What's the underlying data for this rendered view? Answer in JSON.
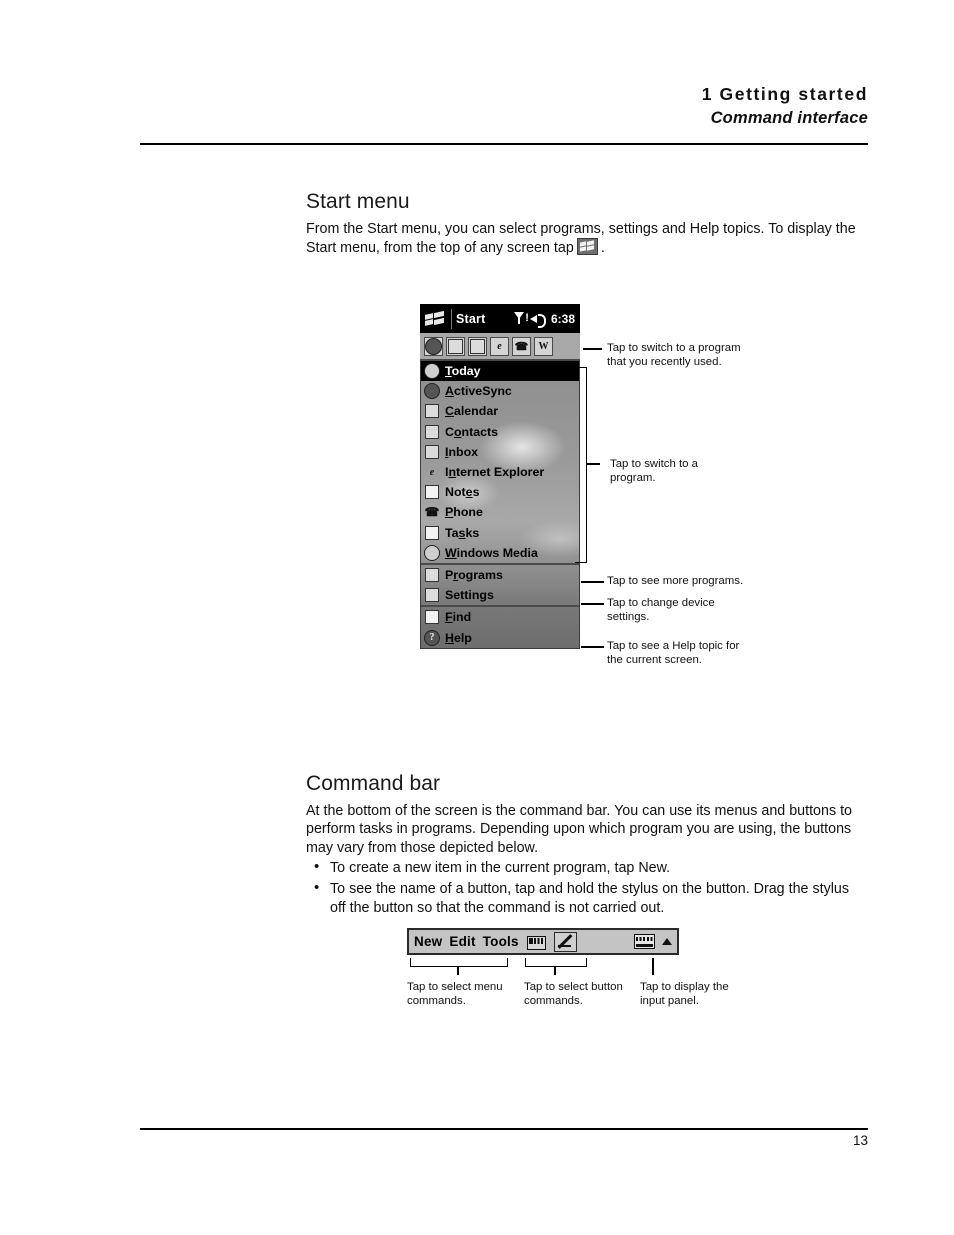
{
  "header": {
    "chapter": "1 Getting started",
    "section": "Command interface"
  },
  "start_menu_section": {
    "title": "Start menu",
    "paragraph_1": "From the Start menu, you can select programs, settings and Help topics. To display the",
    "paragraph_2_before_icon": "Start menu, from the top of any screen tap",
    "paragraph_2_after_icon": "."
  },
  "pda": {
    "titlebar": {
      "start_label": "Start",
      "time": "6:38",
      "signal_icon": "signal-bars-icon",
      "speaker_icon": "speaker-icon",
      "start_icon": "windows-flag-icon"
    },
    "recent_programs": [
      {
        "name": "ActiveSync",
        "icon": "activesync-icon",
        "glyph": ""
      },
      {
        "name": "Calendar",
        "icon": "calendar-icon",
        "glyph": ""
      },
      {
        "name": "Contacts",
        "icon": "contacts-icon",
        "glyph": ""
      },
      {
        "name": "Internet Explorer",
        "icon": "internet-explorer-icon",
        "glyph": "e"
      },
      {
        "name": "Phone",
        "icon": "phone-icon",
        "glyph": ""
      },
      {
        "name": "Word",
        "icon": "word-icon",
        "glyph": "W"
      }
    ],
    "menu_groups": [
      {
        "items": [
          {
            "label": "Today",
            "accel": "T",
            "selected": true,
            "icon": "today-icon"
          },
          {
            "label": "ActiveSync",
            "accel": "A",
            "selected": false,
            "icon": "activesync-icon"
          },
          {
            "label": "Calendar",
            "accel": "C",
            "selected": false,
            "icon": "calendar-icon"
          },
          {
            "label": "Contacts",
            "accel": "o",
            "selected": false,
            "icon": "contacts-icon"
          },
          {
            "label": "Inbox",
            "accel": "I",
            "selected": false,
            "icon": "inbox-icon"
          },
          {
            "label": "Internet Explorer",
            "accel": "n",
            "selected": false,
            "icon": "internet-explorer-icon"
          },
          {
            "label": "Notes",
            "accel": "e",
            "selected": false,
            "icon": "notes-icon"
          },
          {
            "label": "Phone",
            "accel": "P",
            "selected": false,
            "icon": "phone-icon"
          },
          {
            "label": "Tasks",
            "accel": "s",
            "selected": false,
            "icon": "tasks-icon"
          },
          {
            "label": "Windows Media",
            "accel": "W",
            "selected": false,
            "icon": "windows-media-icon"
          }
        ]
      },
      {
        "items": [
          {
            "label": "Programs",
            "accel": "r",
            "selected": false,
            "icon": "programs-folder-icon"
          },
          {
            "label": "Settings",
            "accel": "g",
            "selected": false,
            "icon": "settings-folder-icon"
          }
        ]
      },
      {
        "items": [
          {
            "label": "Find",
            "accel": "F",
            "selected": false,
            "icon": "find-icon"
          },
          {
            "label": "Help",
            "accel": "H",
            "selected": false,
            "icon": "help-icon"
          }
        ]
      }
    ]
  },
  "start_callouts": [
    {
      "id": "recent-programs-callout",
      "line1": "Tap to switch to a program",
      "line2": "that you recently used."
    },
    {
      "id": "switch-program-callout",
      "line1": "Tap to switch to a",
      "line2": "program."
    },
    {
      "id": "programs-callout",
      "line1": "Tap to see more programs.",
      "line2": ""
    },
    {
      "id": "settings-callout",
      "line1": "Tap to change device",
      "line2": "settings."
    },
    {
      "id": "help-callout",
      "line1": "Tap to see a Help topic for",
      "line2": "the current screen."
    }
  ],
  "command_bar_section": {
    "title": "Command bar",
    "paragraph": "At the bottom of the screen is the command bar. You can use its menus and buttons to perform tasks in programs. Depending upon which program you are using, the buttons may vary from those depicted below.",
    "bullets": [
      "To create a new item in the current program, tap New.",
      "To see the name of a button, tap and hold the stylus on the button. Drag the stylus off the button so that the command is not carried out."
    ]
  },
  "command_bar": {
    "menus": [
      "New",
      "Edit",
      "Tools"
    ],
    "buttons": [
      {
        "name": "paragraph-button",
        "icon": "paragraph-icon",
        "pressed": false
      },
      {
        "name": "draw-button",
        "icon": "pencil-icon",
        "pressed": true
      }
    ],
    "input_panel_icon": "keyboard-icon",
    "input_panel_arrow_icon": "up-arrow-icon",
    "captions": [
      {
        "id": "menu-commands-caption",
        "line1": "Tap to select menu",
        "line2": "commands."
      },
      {
        "id": "button-commands-caption",
        "line1": "Tap to select button",
        "line2": "commands."
      },
      {
        "id": "input-panel-caption",
        "line1": "Tap to display the",
        "line2": "input panel."
      }
    ]
  },
  "footer": {
    "page_number": "13"
  }
}
